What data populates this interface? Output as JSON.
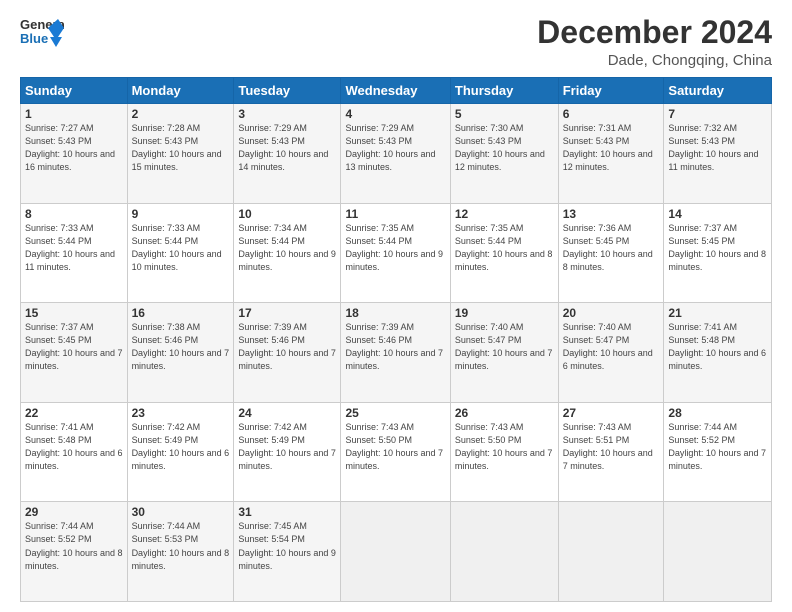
{
  "logo": {
    "line1": "General",
    "line2": "Blue"
  },
  "title": "December 2024",
  "subtitle": "Dade, Chongqing, China",
  "weekdays": [
    "Sunday",
    "Monday",
    "Tuesday",
    "Wednesday",
    "Thursday",
    "Friday",
    "Saturday"
  ],
  "weeks": [
    [
      {
        "day": "1",
        "sunrise": "Sunrise: 7:27 AM",
        "sunset": "Sunset: 5:43 PM",
        "daylight": "Daylight: 10 hours and 16 minutes."
      },
      {
        "day": "2",
        "sunrise": "Sunrise: 7:28 AM",
        "sunset": "Sunset: 5:43 PM",
        "daylight": "Daylight: 10 hours and 15 minutes."
      },
      {
        "day": "3",
        "sunrise": "Sunrise: 7:29 AM",
        "sunset": "Sunset: 5:43 PM",
        "daylight": "Daylight: 10 hours and 14 minutes."
      },
      {
        "day": "4",
        "sunrise": "Sunrise: 7:29 AM",
        "sunset": "Sunset: 5:43 PM",
        "daylight": "Daylight: 10 hours and 13 minutes."
      },
      {
        "day": "5",
        "sunrise": "Sunrise: 7:30 AM",
        "sunset": "Sunset: 5:43 PM",
        "daylight": "Daylight: 10 hours and 12 minutes."
      },
      {
        "day": "6",
        "sunrise": "Sunrise: 7:31 AM",
        "sunset": "Sunset: 5:43 PM",
        "daylight": "Daylight: 10 hours and 12 minutes."
      },
      {
        "day": "7",
        "sunrise": "Sunrise: 7:32 AM",
        "sunset": "Sunset: 5:43 PM",
        "daylight": "Daylight: 10 hours and 11 minutes."
      }
    ],
    [
      {
        "day": "8",
        "sunrise": "Sunrise: 7:33 AM",
        "sunset": "Sunset: 5:44 PM",
        "daylight": "Daylight: 10 hours and 11 minutes."
      },
      {
        "day": "9",
        "sunrise": "Sunrise: 7:33 AM",
        "sunset": "Sunset: 5:44 PM",
        "daylight": "Daylight: 10 hours and 10 minutes."
      },
      {
        "day": "10",
        "sunrise": "Sunrise: 7:34 AM",
        "sunset": "Sunset: 5:44 PM",
        "daylight": "Daylight: 10 hours and 9 minutes."
      },
      {
        "day": "11",
        "sunrise": "Sunrise: 7:35 AM",
        "sunset": "Sunset: 5:44 PM",
        "daylight": "Daylight: 10 hours and 9 minutes."
      },
      {
        "day": "12",
        "sunrise": "Sunrise: 7:35 AM",
        "sunset": "Sunset: 5:44 PM",
        "daylight": "Daylight: 10 hours and 8 minutes."
      },
      {
        "day": "13",
        "sunrise": "Sunrise: 7:36 AM",
        "sunset": "Sunset: 5:45 PM",
        "daylight": "Daylight: 10 hours and 8 minutes."
      },
      {
        "day": "14",
        "sunrise": "Sunrise: 7:37 AM",
        "sunset": "Sunset: 5:45 PM",
        "daylight": "Daylight: 10 hours and 8 minutes."
      }
    ],
    [
      {
        "day": "15",
        "sunrise": "Sunrise: 7:37 AM",
        "sunset": "Sunset: 5:45 PM",
        "daylight": "Daylight: 10 hours and 7 minutes."
      },
      {
        "day": "16",
        "sunrise": "Sunrise: 7:38 AM",
        "sunset": "Sunset: 5:46 PM",
        "daylight": "Daylight: 10 hours and 7 minutes."
      },
      {
        "day": "17",
        "sunrise": "Sunrise: 7:39 AM",
        "sunset": "Sunset: 5:46 PM",
        "daylight": "Daylight: 10 hours and 7 minutes."
      },
      {
        "day": "18",
        "sunrise": "Sunrise: 7:39 AM",
        "sunset": "Sunset: 5:46 PM",
        "daylight": "Daylight: 10 hours and 7 minutes."
      },
      {
        "day": "19",
        "sunrise": "Sunrise: 7:40 AM",
        "sunset": "Sunset: 5:47 PM",
        "daylight": "Daylight: 10 hours and 7 minutes."
      },
      {
        "day": "20",
        "sunrise": "Sunrise: 7:40 AM",
        "sunset": "Sunset: 5:47 PM",
        "daylight": "Daylight: 10 hours and 6 minutes."
      },
      {
        "day": "21",
        "sunrise": "Sunrise: 7:41 AM",
        "sunset": "Sunset: 5:48 PM",
        "daylight": "Daylight: 10 hours and 6 minutes."
      }
    ],
    [
      {
        "day": "22",
        "sunrise": "Sunrise: 7:41 AM",
        "sunset": "Sunset: 5:48 PM",
        "daylight": "Daylight: 10 hours and 6 minutes."
      },
      {
        "day": "23",
        "sunrise": "Sunrise: 7:42 AM",
        "sunset": "Sunset: 5:49 PM",
        "daylight": "Daylight: 10 hours and 6 minutes."
      },
      {
        "day": "24",
        "sunrise": "Sunrise: 7:42 AM",
        "sunset": "Sunset: 5:49 PM",
        "daylight": "Daylight: 10 hours and 7 minutes."
      },
      {
        "day": "25",
        "sunrise": "Sunrise: 7:43 AM",
        "sunset": "Sunset: 5:50 PM",
        "daylight": "Daylight: 10 hours and 7 minutes."
      },
      {
        "day": "26",
        "sunrise": "Sunrise: 7:43 AM",
        "sunset": "Sunset: 5:50 PM",
        "daylight": "Daylight: 10 hours and 7 minutes."
      },
      {
        "day": "27",
        "sunrise": "Sunrise: 7:43 AM",
        "sunset": "Sunset: 5:51 PM",
        "daylight": "Daylight: 10 hours and 7 minutes."
      },
      {
        "day": "28",
        "sunrise": "Sunrise: 7:44 AM",
        "sunset": "Sunset: 5:52 PM",
        "daylight": "Daylight: 10 hours and 7 minutes."
      }
    ],
    [
      {
        "day": "29",
        "sunrise": "Sunrise: 7:44 AM",
        "sunset": "Sunset: 5:52 PM",
        "daylight": "Daylight: 10 hours and 8 minutes."
      },
      {
        "day": "30",
        "sunrise": "Sunrise: 7:44 AM",
        "sunset": "Sunset: 5:53 PM",
        "daylight": "Daylight: 10 hours and 8 minutes."
      },
      {
        "day": "31",
        "sunrise": "Sunrise: 7:45 AM",
        "sunset": "Sunset: 5:54 PM",
        "daylight": "Daylight: 10 hours and 9 minutes."
      },
      null,
      null,
      null,
      null
    ]
  ]
}
